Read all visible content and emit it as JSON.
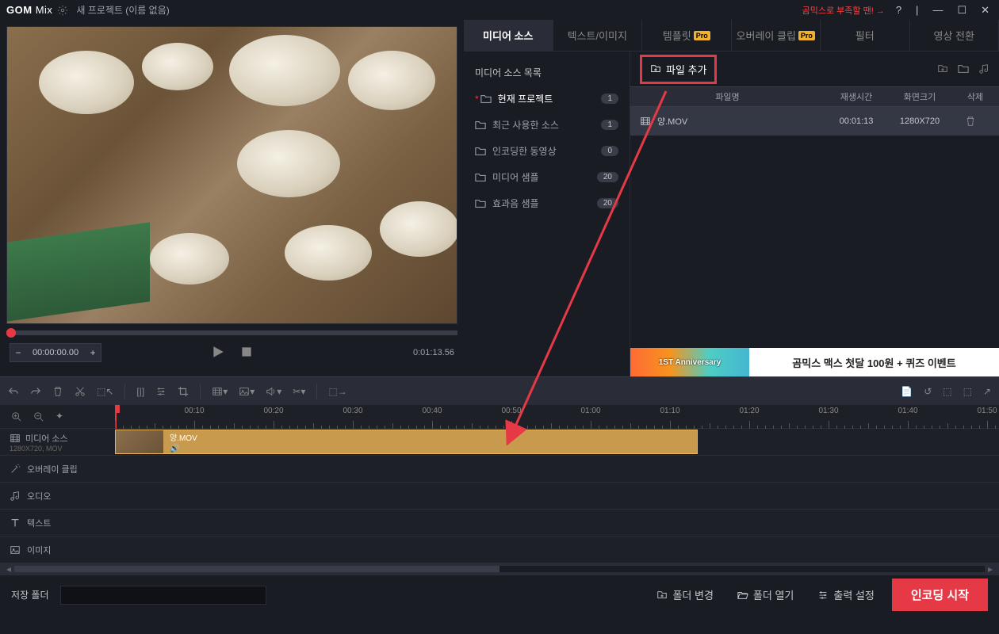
{
  "titlebar": {
    "logo_a": "GOM",
    "logo_b": "Mix",
    "project_title": "새 프로젝트 (이름 없음)",
    "promo": "곰믹스로 부족할 땐! →",
    "help": "?"
  },
  "preview": {
    "current_time": "00:00:00.00",
    "duration": "0:01:13.56"
  },
  "tabs": {
    "media": "미디어 소스",
    "text": "텍스트/이미지",
    "template": "템플릿",
    "overlay": "오버레이 클립",
    "filter": "필터",
    "transition": "영상 전환",
    "pro": "Pro"
  },
  "media_sidebar": {
    "title": "미디어 소스 목록",
    "cats": [
      {
        "label": "현재 프로젝트",
        "count": "1",
        "active": true,
        "ast": true
      },
      {
        "label": "최근 사용한 소스",
        "count": "1"
      },
      {
        "label": "인코딩한 동영상",
        "count": "0"
      },
      {
        "label": "미디어 샘플",
        "count": "20"
      },
      {
        "label": "효과음 샘플",
        "count": "20"
      }
    ]
  },
  "files": {
    "add_label": "파일 추가",
    "headers": {
      "name": "파일명",
      "dur": "재생시간",
      "size": "화면크기",
      "del": "삭제"
    },
    "rows": [
      {
        "name": "양.MOV",
        "dur": "00:01:13",
        "size": "1280X720"
      }
    ]
  },
  "banner": {
    "img_text": "1ST Anniversary",
    "text": "곰믹스 맥스 첫달 100원 + 퀴즈 이벤트"
  },
  "ruler": {
    "labels": [
      "00:10",
      "00:20",
      "00:30",
      "00:40",
      "00:50",
      "01:00",
      "01:10",
      "01:20",
      "01:30",
      "01:40",
      "01:50"
    ]
  },
  "tracks": {
    "media": "미디어 소스",
    "media_sub": "1280X720, MOV",
    "overlay": "오버레이 클립",
    "audio": "오디오",
    "text": "텍스트",
    "image": "이미지"
  },
  "clip": {
    "name": "양.MOV"
  },
  "bottom": {
    "save_folder": "저장 폴더",
    "change_folder": "폴더 변경",
    "open_folder": "폴더 열기",
    "output_settings": "출력 설정",
    "encode": "인코딩 시작"
  }
}
